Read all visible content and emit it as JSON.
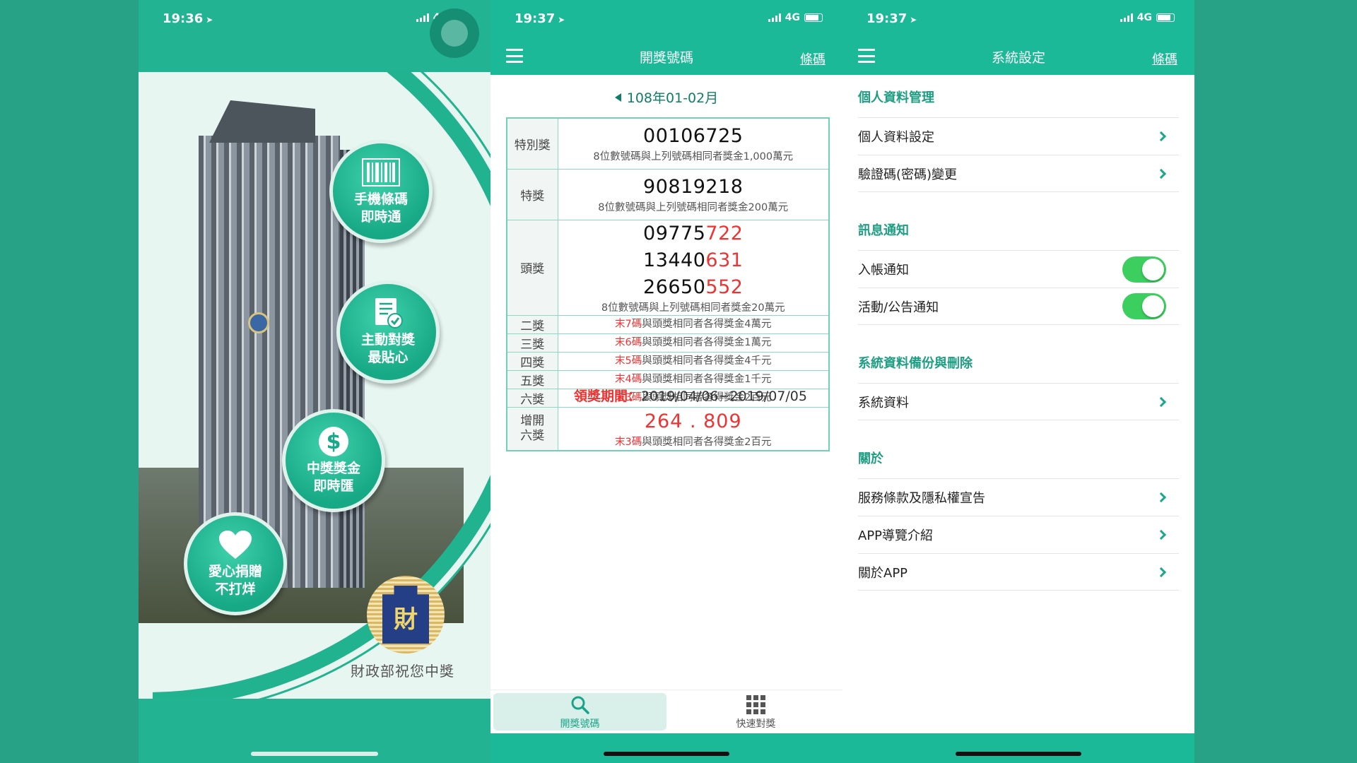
{
  "phone1": {
    "status": {
      "time": "19:36",
      "network": "4G"
    },
    "bubbles": [
      {
        "line1": "手機條碼",
        "line2": "即時通",
        "icon": "barcode-icon"
      },
      {
        "line1": "主動對獎",
        "line2": "最貼心",
        "icon": "checklist-icon"
      },
      {
        "line1": "中獎獎金",
        "line2": "即時匯",
        "icon": "dollar-icon"
      },
      {
        "line1": "愛心捐贈",
        "line2": "不打烊",
        "icon": "heart-icon"
      }
    ],
    "footer_text": "財政部祝您中獎",
    "logo_char": "財"
  },
  "phone2": {
    "status": {
      "time": "19:37",
      "network": "4G"
    },
    "title": "開獎號碼",
    "link": "條碼",
    "period": "108年01-02月",
    "prizes": {
      "special": {
        "label": "特別獎",
        "number": "00106725",
        "note": "8位數號碼與上列號碼相同者獎金1,000萬元"
      },
      "grand": {
        "label": "特獎",
        "number": "90819218",
        "note": "8位數號碼與上列號碼相同者獎金200萬元"
      },
      "first": {
        "label": "頭獎",
        "numbers": [
          {
            "prefix": "09775",
            "suffix": "722"
          },
          {
            "prefix": "13440",
            "suffix": "631"
          },
          {
            "prefix": "26650",
            "suffix": "552"
          }
        ],
        "note": "8位數號碼與上列號碼相同者獎金20萬元"
      },
      "lower": [
        {
          "label": "二獎",
          "red": "末7碼",
          "rest": "與頭獎相同者各得獎金4萬元"
        },
        {
          "label": "三獎",
          "red": "末6碼",
          "rest": "與頭獎相同者各得獎金1萬元"
        },
        {
          "label": "四獎",
          "red": "末5碼",
          "rest": "與頭獎相同者各得獎金4千元"
        },
        {
          "label": "五獎",
          "red": "末4碼",
          "rest": "與頭獎相同者各得獎金1千元"
        },
        {
          "label": "六獎",
          "red": "末3碼",
          "rest": "與頭獎相同者各得獎金2百元"
        }
      ],
      "extra": {
        "label_line1": "增開",
        "label_line2": "六獎",
        "numbers": "264 . 809",
        "red": "末3碼",
        "rest": "與頭獎相同者各得獎金2百元"
      }
    },
    "claim_label": "領獎期間：",
    "claim_period": "2019/04/06~2019/07/05",
    "tabs": [
      {
        "label": "開獎號碼",
        "icon": "search-icon",
        "active": true
      },
      {
        "label": "快速對獎",
        "icon": "grid-icon",
        "active": false
      }
    ]
  },
  "phone3": {
    "status": {
      "time": "19:37",
      "network": "4G"
    },
    "title": "系統設定",
    "link": "條碼",
    "sections": [
      {
        "title": "個人資料管理",
        "rows": [
          {
            "label": "個人資料設定",
            "type": "link"
          },
          {
            "label": "驗證碼(密碼)變更",
            "type": "link"
          }
        ]
      },
      {
        "title": "訊息通知",
        "rows": [
          {
            "label": "入帳通知",
            "type": "toggle",
            "on": true
          },
          {
            "label": "活動/公告通知",
            "type": "toggle",
            "on": true
          }
        ]
      },
      {
        "title": "系統資料備份與刪除",
        "rows": [
          {
            "label": "系統資料",
            "type": "link"
          }
        ]
      },
      {
        "title": "關於",
        "rows": [
          {
            "label": "服務條款及隱私權宣告",
            "type": "link"
          },
          {
            "label": "APP導覽介紹",
            "type": "link"
          },
          {
            "label": "關於APP",
            "type": "link"
          }
        ]
      }
    ]
  },
  "colors": {
    "brand_green": "#1cb999",
    "accent_dark": "#1d9e83",
    "winning_red": "#e33333",
    "toggle_on": "#3ccf60"
  }
}
